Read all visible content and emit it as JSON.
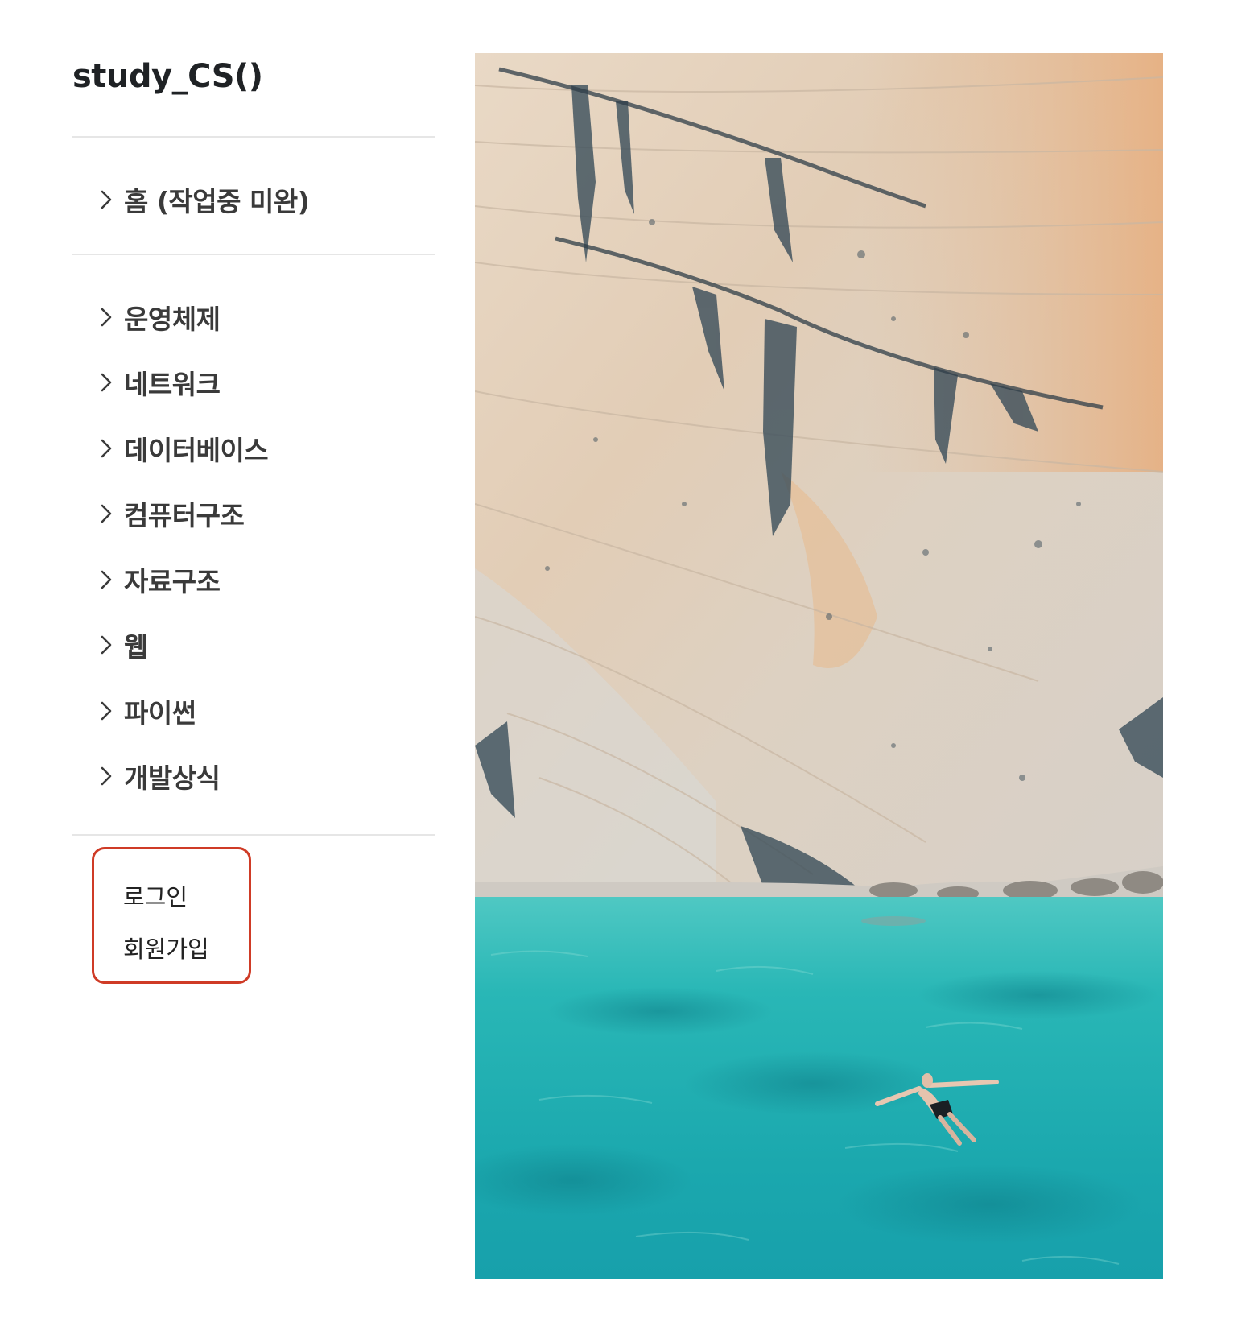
{
  "sidebar": {
    "title": "study_CS()",
    "home": {
      "label": "홈 (작업중 미완)",
      "icon": "chevron-right-icon"
    },
    "categories": [
      {
        "label": "운영체제",
        "icon": "chevron-right-icon"
      },
      {
        "label": "네트워크",
        "icon": "chevron-right-icon"
      },
      {
        "label": "데이터베이스",
        "icon": "chevron-right-icon"
      },
      {
        "label": "컴퓨터구조",
        "icon": "chevron-right-icon"
      },
      {
        "label": "자료구조",
        "icon": "chevron-right-icon"
      },
      {
        "label": "웹",
        "icon": "chevron-right-icon"
      },
      {
        "label": "파이썬",
        "icon": "chevron-right-icon"
      },
      {
        "label": "개발상식",
        "icon": "chevron-right-icon"
      }
    ],
    "auth": {
      "login": "로그인",
      "signup": "회원가입",
      "highlight_color": "#cf3b26"
    }
  },
  "hero_image": {
    "subject": "limestone-cliff-turquoise-sea-swimmer",
    "colors": {
      "cliff": "#e3d4c2",
      "water": "#23b5b4"
    }
  }
}
